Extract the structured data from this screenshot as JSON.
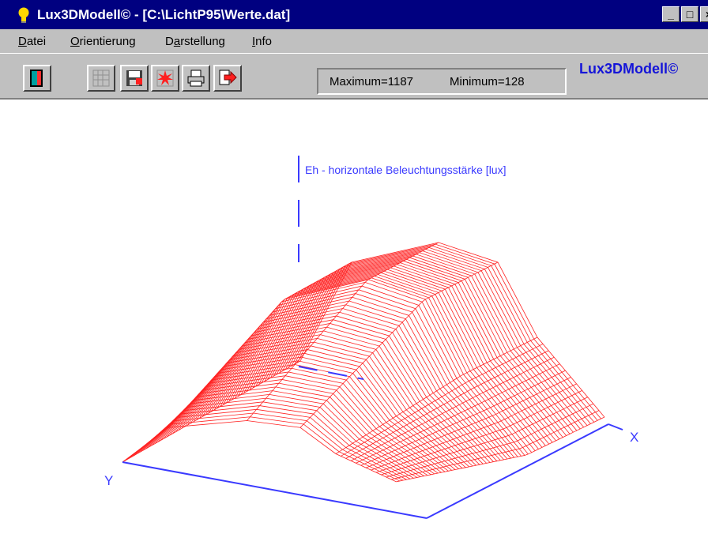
{
  "window": {
    "title": "Lux3DModell© - [C:\\LichtP95\\Werte.dat]",
    "buttons": [
      "_",
      "□",
      "×"
    ]
  },
  "menu": [
    {
      "accel": "D",
      "rest": "atei"
    },
    {
      "accel": "O",
      "rest": "rientierung"
    },
    {
      "pre": "D",
      "accel": "a",
      "rest": "rstellung"
    },
    {
      "accel": "I",
      "rest": "nfo"
    }
  ],
  "toolbar": {
    "buttons": [
      {
        "icon": "exit-door-icon"
      },
      {
        "icon": "grid-icon"
      },
      {
        "icon": "save-disk-icon"
      },
      {
        "icon": "burst-icon"
      },
      {
        "icon": "printer-icon"
      },
      {
        "icon": "export-arrow-icon"
      }
    ],
    "status": {
      "maximum": "Maximum=1187",
      "minimum": "Minimum=128"
    },
    "brand": "Lux3DModell©"
  },
  "plot": {
    "z_axis_label": "Eh - horizontale Beleuchtungsstärke [lux]",
    "x_axis_label": "X",
    "y_axis_label": "Y",
    "axis_color": "#3a3aff",
    "mesh_color": "#ff2020",
    "value_range": {
      "maximum": 1187,
      "minimum": 128
    }
  }
}
